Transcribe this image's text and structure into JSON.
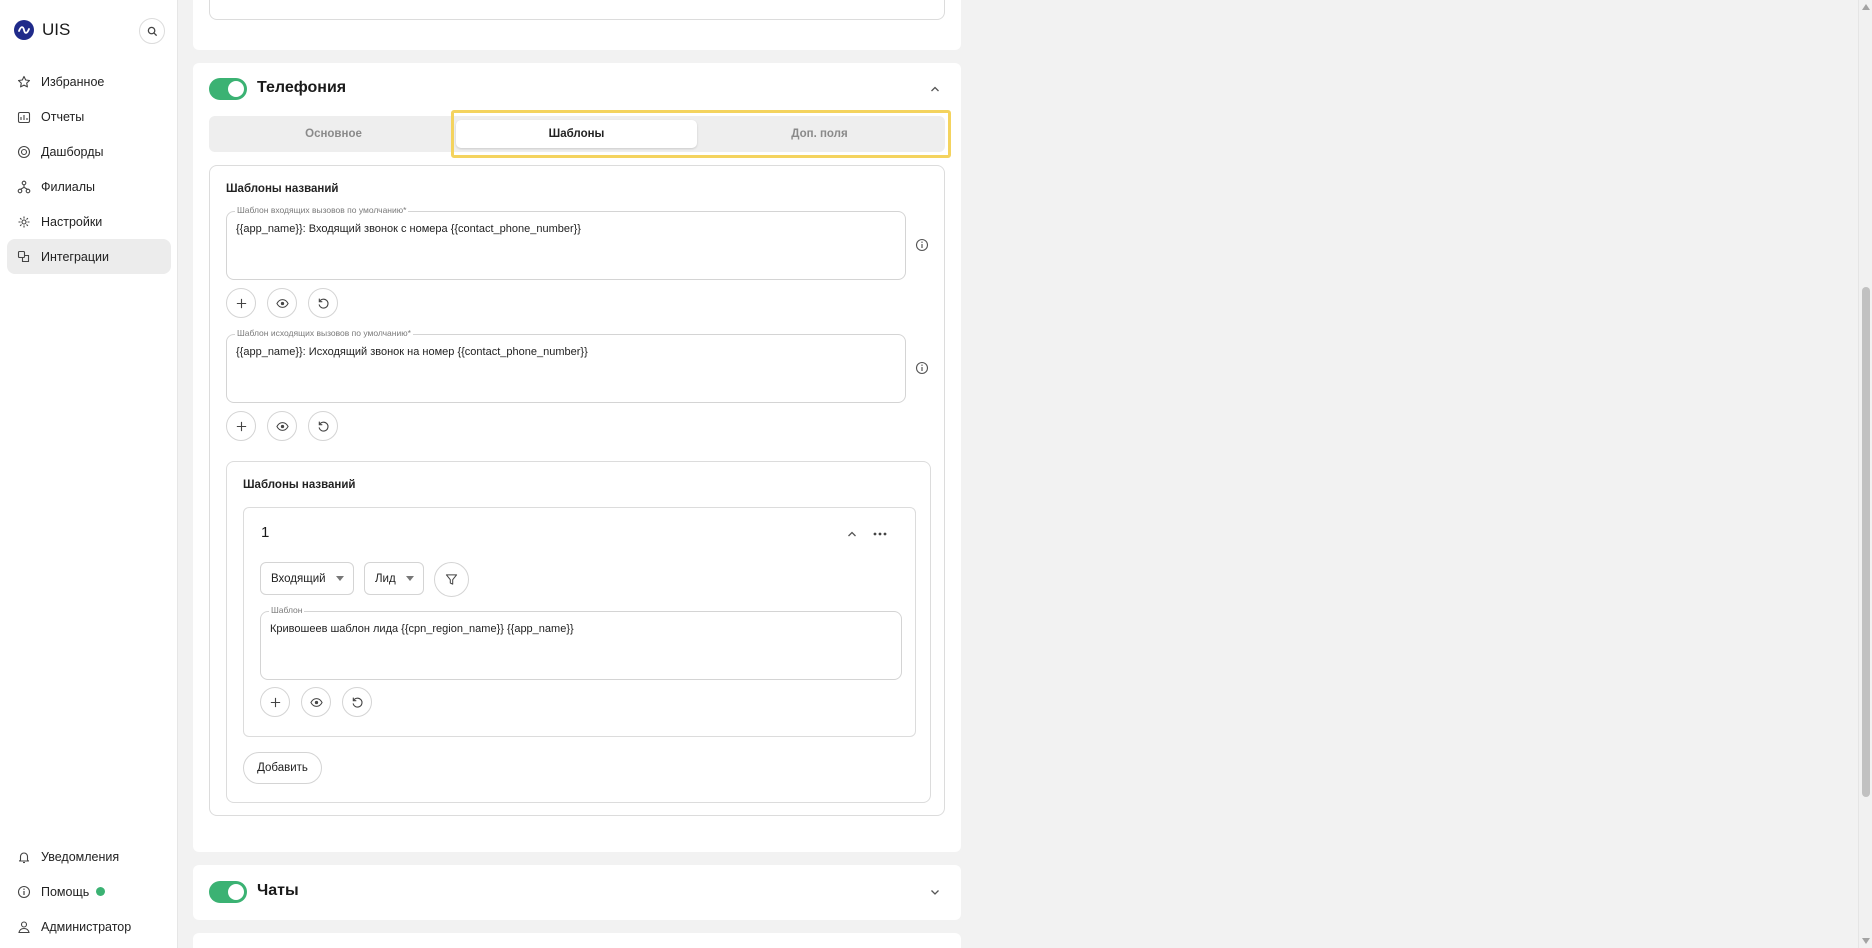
{
  "app": {
    "name": "UIS"
  },
  "sidebar": {
    "items": [
      {
        "label": "Избранное",
        "icon": "star-icon"
      },
      {
        "label": "Отчеты",
        "icon": "report-icon"
      },
      {
        "label": "Дашборды",
        "icon": "dashboard-icon"
      },
      {
        "label": "Филиалы",
        "icon": "branches-icon"
      },
      {
        "label": "Настройки",
        "icon": "gear-icon"
      },
      {
        "label": "Интеграции",
        "icon": "integrations-icon",
        "active": true
      }
    ],
    "bottom": [
      {
        "label": "Уведомления",
        "icon": "bell-icon"
      },
      {
        "label": "Помощь",
        "icon": "info-icon",
        "status_color": "#3bb273"
      },
      {
        "label": "Администратор",
        "icon": "user-icon"
      }
    ]
  },
  "telephony": {
    "title": "Телефония",
    "enabled": true,
    "tabs": [
      {
        "label": "Основное"
      },
      {
        "label": "Шаблоны",
        "active": true
      },
      {
        "label": "Доп. поля"
      }
    ],
    "section_title": "Шаблоны названий",
    "incoming": {
      "label": "Шаблон входящих вызовов по умолчанию*",
      "value": "{{app_name}}: Входящий звонок с номера {{contact_phone_number}}"
    },
    "outgoing": {
      "label": "Шаблон исходящих вызовов по умолчанию*",
      "value": "{{app_name}}: Исходящий звонок на номер {{contact_phone_number}}"
    },
    "sub_section": {
      "title": "Шаблоны названий",
      "item": {
        "number": "1",
        "direction": "Входящий",
        "entity": "Лид",
        "template_label": "Шаблон",
        "template_value": "Кривошеев шаблон лида {{cpn_region_name}} {{app_name}}"
      },
      "add_label": "Добавить"
    }
  },
  "chats": {
    "title": "Чаты",
    "enabled": true
  },
  "colors": {
    "accent": "#3bb273",
    "highlight": "#f4d35e",
    "brand": "#1f2a8a"
  }
}
